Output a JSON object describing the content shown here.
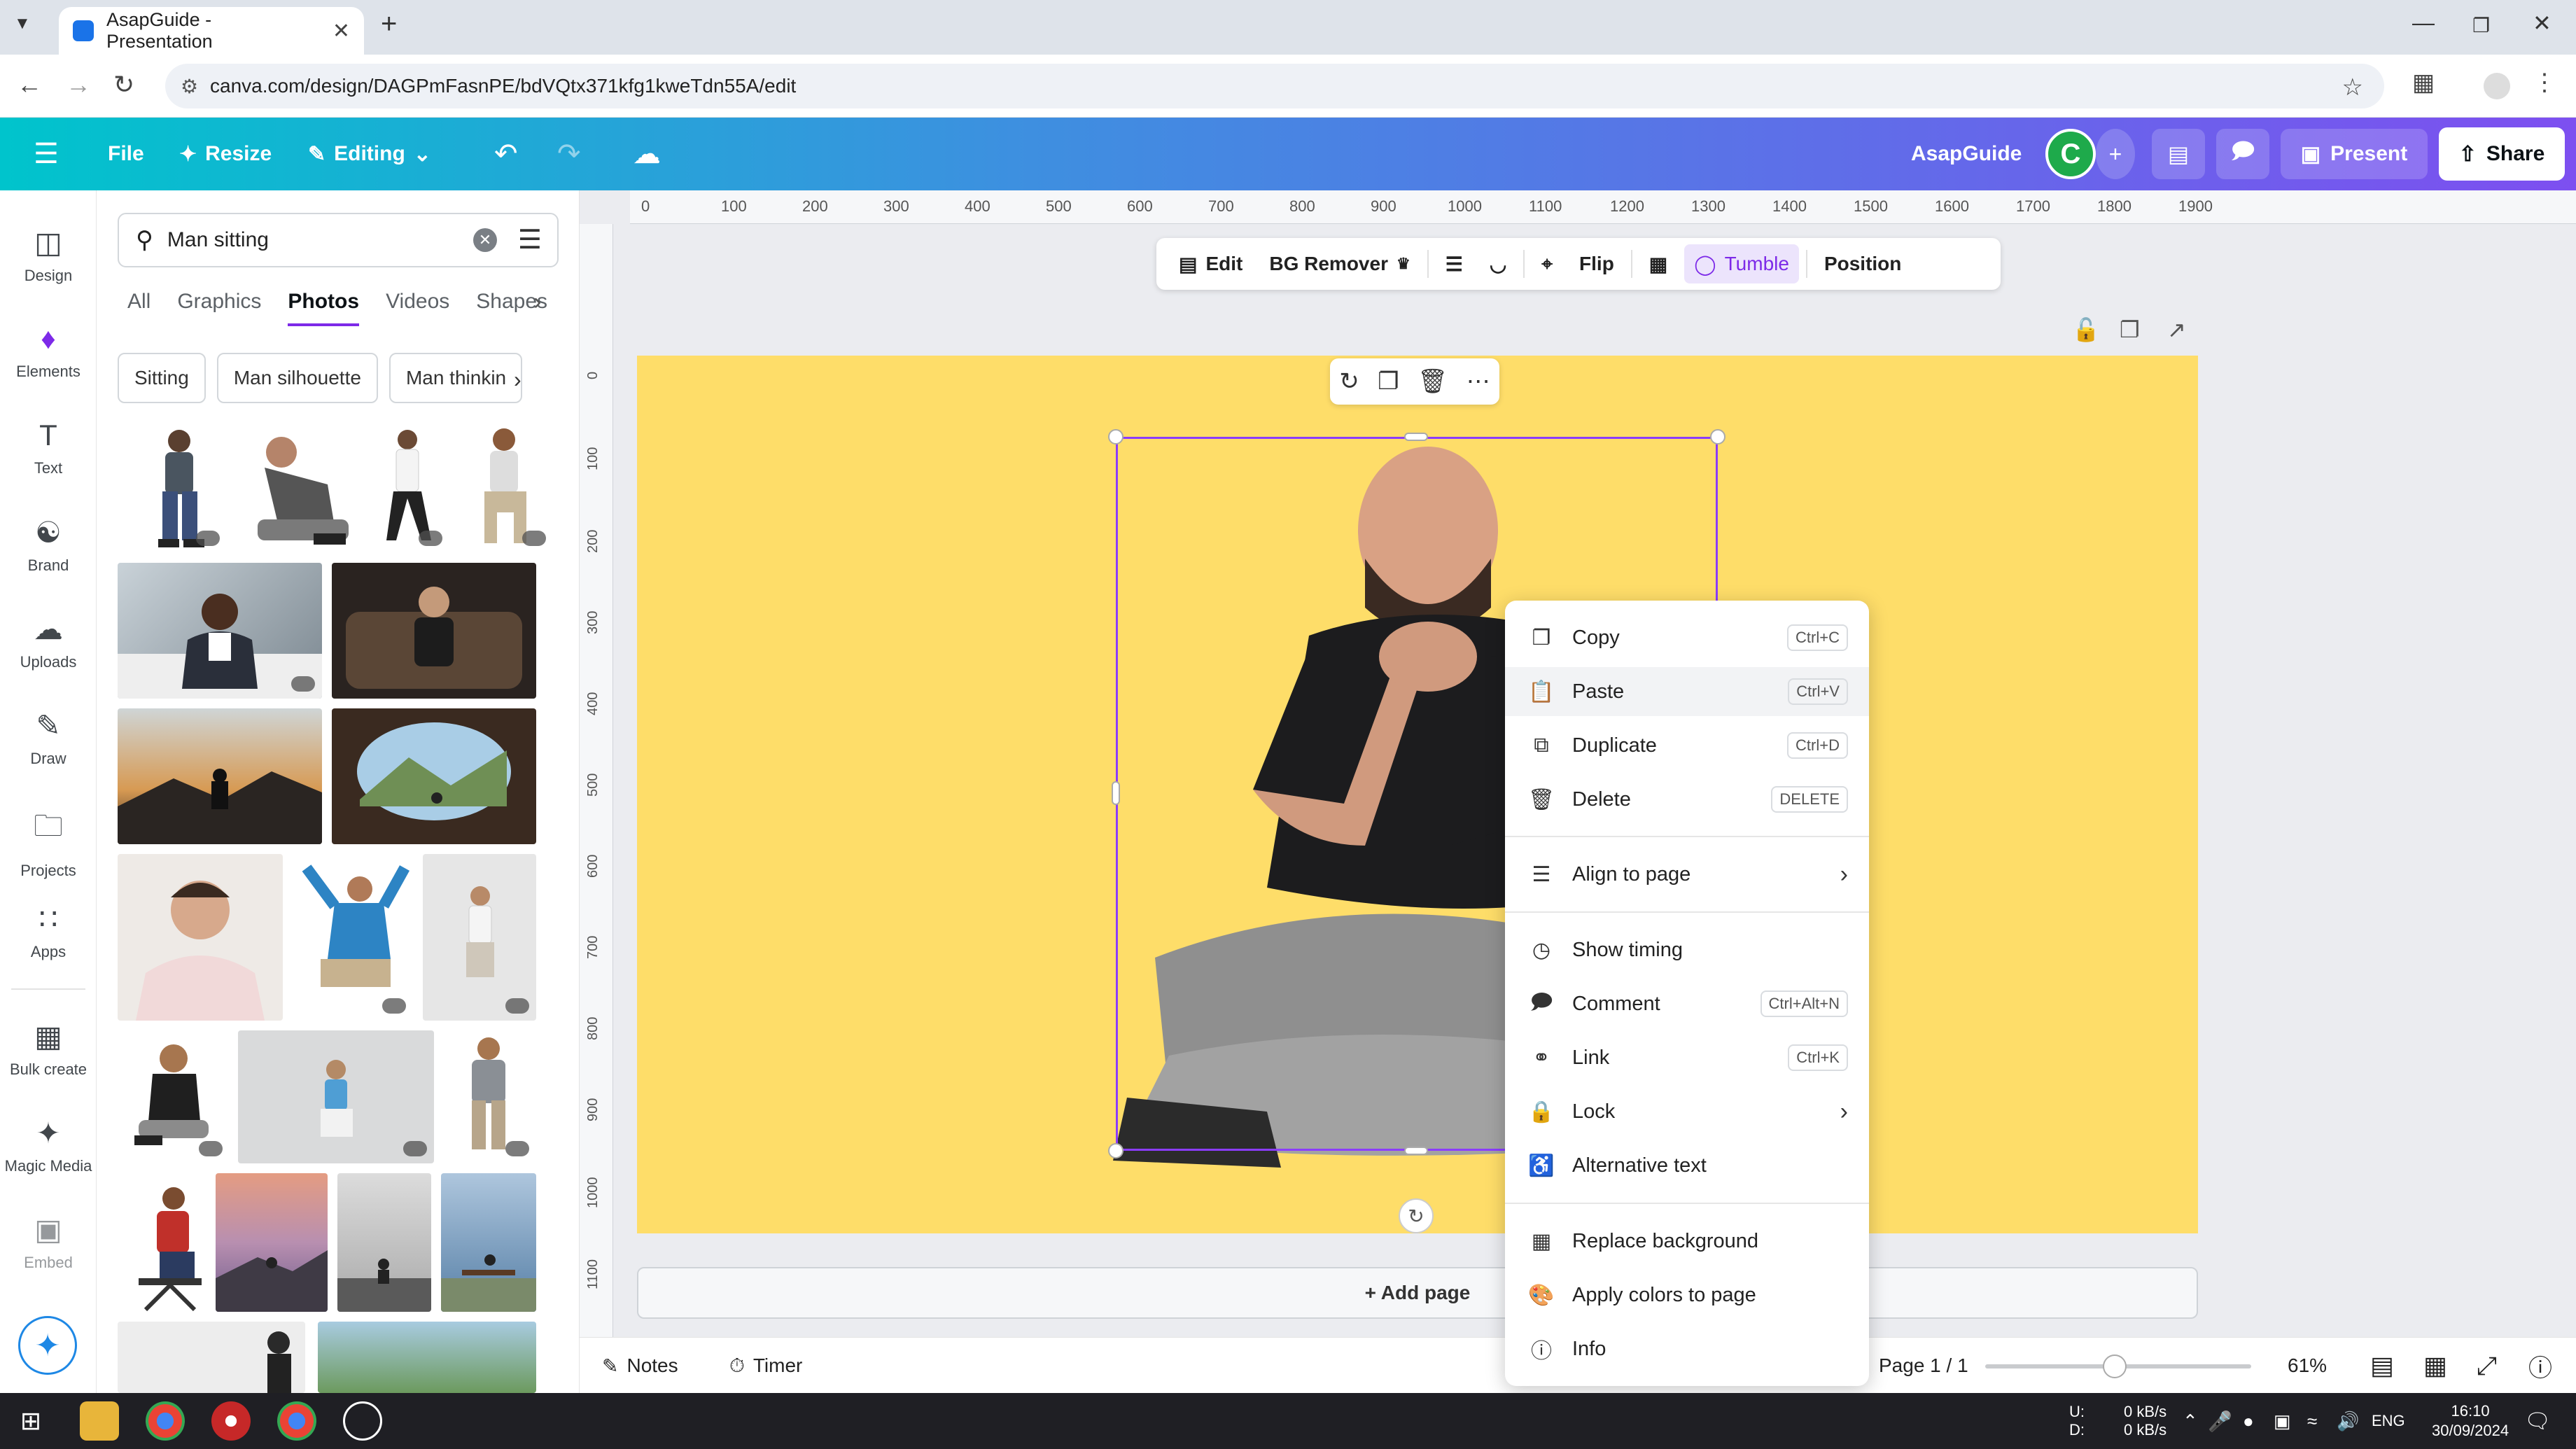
{
  "browser": {
    "tab_title": "AsapGuide - Presentation",
    "url": "canva.com/design/DAGPmFasnPE/bdVQtx371kfg1kweTdn55A/edit"
  },
  "toolbar": {
    "file": "File",
    "resize": "Resize",
    "editing": "Editing",
    "team_name": "AsapGuide",
    "avatar_letter": "C",
    "present": "Present",
    "share": "Share"
  },
  "rail": [
    {
      "label": "Design",
      "icon": "design-icon"
    },
    {
      "label": "Elements",
      "icon": "elements-icon"
    },
    {
      "label": "Text",
      "icon": "text-icon"
    },
    {
      "label": "Brand",
      "icon": "brand-icon"
    },
    {
      "label": "Uploads",
      "icon": "uploads-icon"
    },
    {
      "label": "Draw",
      "icon": "draw-icon"
    },
    {
      "label": "Projects",
      "icon": "projects-icon"
    },
    {
      "label": "Apps",
      "icon": "apps-icon"
    },
    {
      "label": "Bulk create",
      "icon": "bulk-create-icon"
    },
    {
      "label": "Magic Media",
      "icon": "magic-media-icon"
    },
    {
      "label": "Embed",
      "icon": "embed-icon"
    }
  ],
  "panel": {
    "search_value": "Man sitting",
    "tabs": [
      "All",
      "Graphics",
      "Photos",
      "Videos",
      "Shapes"
    ],
    "active_tab": "Photos",
    "chips": [
      "Sitting",
      "Man silhouette",
      "Man thinkin"
    ]
  },
  "ctxbar": {
    "edit": "Edit",
    "bg_remover": "BG Remover",
    "flip": "Flip",
    "tumble": "Tumble",
    "position": "Position"
  },
  "ruler": {
    "top": [
      "0",
      "100",
      "200",
      "300",
      "400",
      "500",
      "600",
      "700",
      "800",
      "900",
      "1000",
      "1100",
      "1200",
      "1300",
      "1400",
      "1500",
      "1600",
      "1700",
      "1800",
      "1900"
    ],
    "left": [
      "0",
      "100",
      "200",
      "300",
      "400",
      "500",
      "600",
      "700",
      "800",
      "900",
      "1000",
      "1100"
    ]
  },
  "canvas": {
    "add_page": "+ Add page",
    "page_color": "#fedd69",
    "selection_color": "#8b3dff"
  },
  "menu": {
    "items": [
      {
        "label": "Copy",
        "shortcut": "Ctrl+C",
        "icon": "copy-icon"
      },
      {
        "label": "Paste",
        "shortcut": "Ctrl+V",
        "icon": "paste-icon"
      },
      {
        "label": "Duplicate",
        "shortcut": "Ctrl+D",
        "icon": "duplicate-icon"
      },
      {
        "label": "Delete",
        "shortcut": "DELETE",
        "icon": "trash-icon"
      },
      {
        "label": "Align to page",
        "icon": "align-icon"
      },
      {
        "label": "Show timing",
        "icon": "clock-icon"
      },
      {
        "label": "Comment",
        "shortcut": "Ctrl+Alt+N",
        "icon": "comment-icon"
      },
      {
        "label": "Link",
        "shortcut": "Ctrl+K",
        "icon": "link-icon"
      },
      {
        "label": "Lock",
        "icon": "lock-icon"
      },
      {
        "label": "Alternative text",
        "icon": "accessibility-icon"
      },
      {
        "label": "Replace background",
        "icon": "replace-background-icon"
      },
      {
        "label": "Apply colors to page",
        "icon": "palette-icon"
      },
      {
        "label": "Info",
        "icon": "info-icon"
      }
    ]
  },
  "footer": {
    "notes": "Notes",
    "timer": "Timer",
    "page_indicator": "Page 1 / 1",
    "zoom": "61%"
  },
  "taskbar": {
    "net_up": "0 kB/s",
    "net_down": "0 kB/s",
    "net_u_label": "U:",
    "net_d_label": "D:",
    "lang": "ENG",
    "time": "16:10",
    "date": "30/09/2024"
  }
}
